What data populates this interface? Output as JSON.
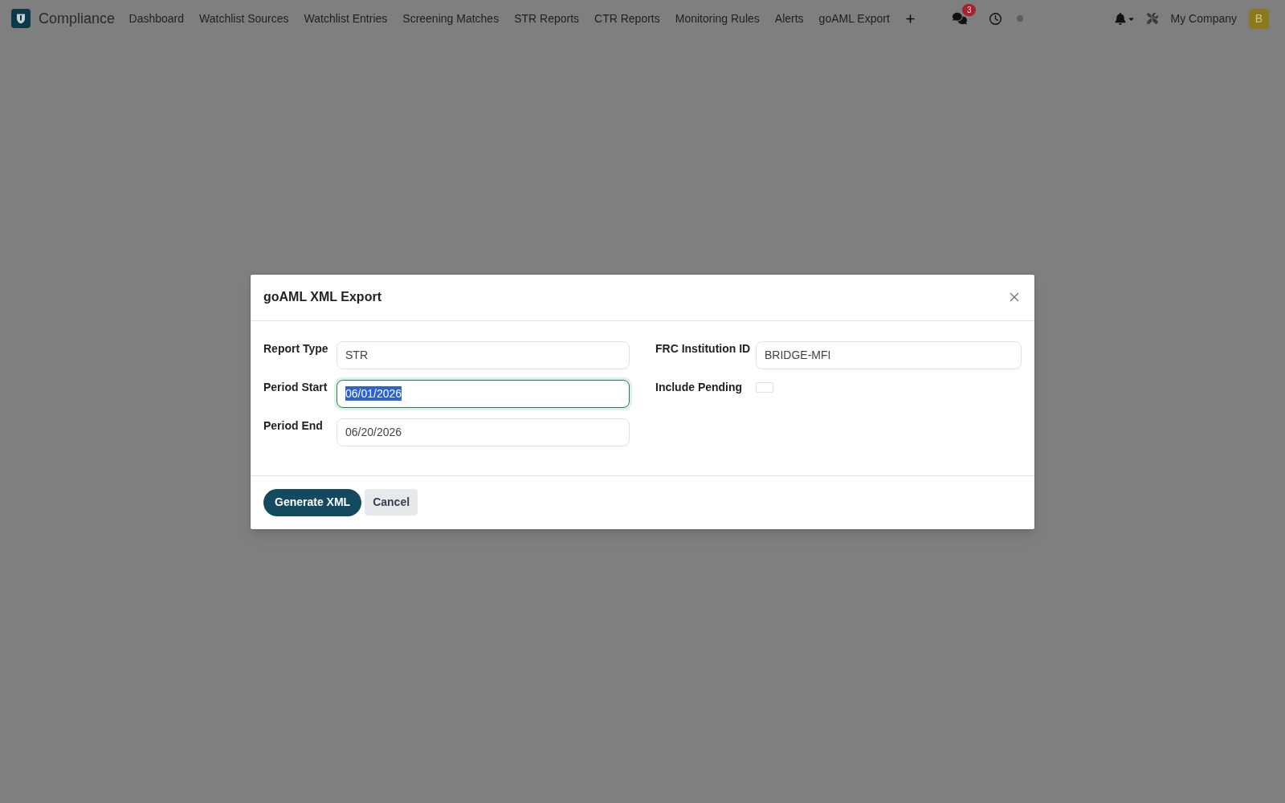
{
  "navbar": {
    "app_name": "Compliance",
    "menu": [
      {
        "label": "Dashboard"
      },
      {
        "label": "Watchlist Sources"
      },
      {
        "label": "Watchlist Entries"
      },
      {
        "label": "Screening Matches"
      },
      {
        "label": "STR Reports"
      },
      {
        "label": "CTR Reports"
      },
      {
        "label": "Monitoring Rules"
      },
      {
        "label": "Alerts"
      },
      {
        "label": "goAML Export"
      }
    ],
    "chat_badge": "3",
    "company": "My Company",
    "avatar_initial": "B"
  },
  "dialog": {
    "title": "goAML XML Export",
    "columns": [
      {
        "fields": [
          {
            "kind": "text",
            "label": "Report Type",
            "value": "STR",
            "focused": false
          },
          {
            "kind": "text",
            "label": "Period Start",
            "value": "06/01/2026",
            "focused": true
          },
          {
            "kind": "text",
            "label": "Period End",
            "value": "06/20/2026",
            "focused": false
          }
        ]
      },
      {
        "fields": [
          {
            "kind": "text",
            "label": "FRC Institution ID",
            "value": "BRIDGE-MFI",
            "focused": false
          },
          {
            "kind": "checkbox",
            "label": "Include Pending",
            "checked": false
          }
        ]
      }
    ],
    "buttons": [
      {
        "kind": "primary",
        "label": "Generate XML"
      },
      {
        "kind": "secondary",
        "label": "Cancel"
      }
    ]
  }
}
